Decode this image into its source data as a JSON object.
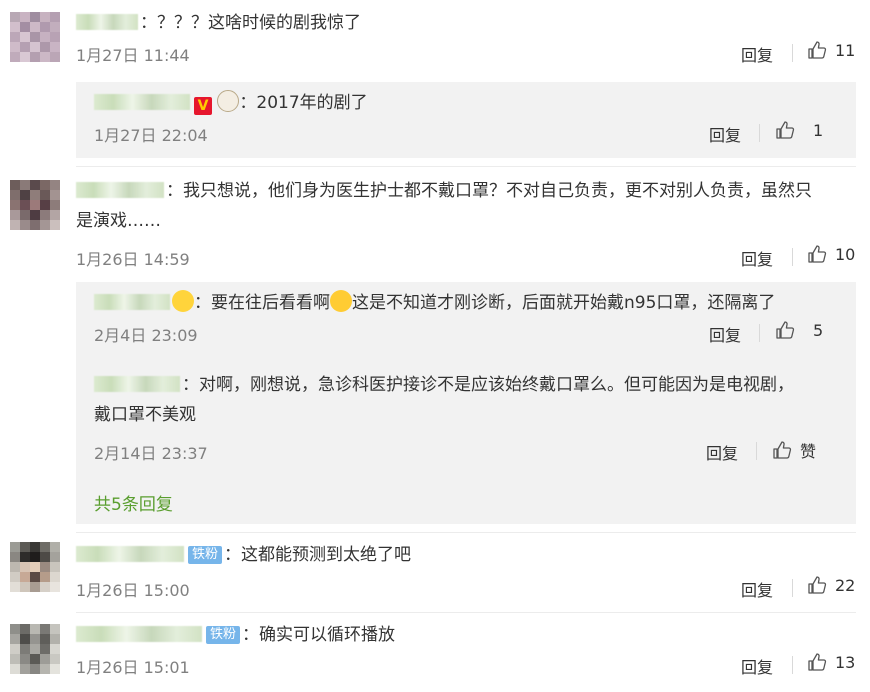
{
  "colors": {
    "link_green": "#5a9e2f",
    "badge_blue": "#76b5ea",
    "subbox_bg": "#f2f2f2",
    "meta_gray": "#808080"
  },
  "comments": [
    {
      "text": "：？？？这啥时候的剧我惊了",
      "time": "1月27日 11:44",
      "reply_label": "回复",
      "likes": "11",
      "replies": [
        {
          "text": "：2017年的剧了",
          "time": "1月27日 22:04",
          "reply_label": "回复",
          "likes": "1",
          "icons": [
            "v-badge",
            "sheep-emoji"
          ]
        }
      ]
    },
    {
      "text_line1": "：我只想说，他们身为医生护士都不戴口罩？不对自己负责，更不对别人负责，虽然只",
      "text_line2": "是演戏……",
      "time": "1月26日 14:59",
      "reply_label": "回复",
      "likes": "10",
      "replies": [
        {
          "text_a": "：要在往后看看啊",
          "text_b": "这是不知道才刚诊断，后面就开始戴n95口罩，还隔离了",
          "time": "2月4日 23:09",
          "reply_label": "回复",
          "likes": "5",
          "icons": [
            "angry-emoji",
            "laugh-cry-emoji"
          ]
        },
        {
          "text_line1": "：对啊，刚想说，急诊科医护接诊不是应该始终戴口罩么。但可能因为是电视剧，",
          "text_line2": "戴口罩不美观",
          "time": "2月14日 23:37",
          "reply_label": "回复",
          "likes": "赞"
        }
      ],
      "more_replies": "共5条回复"
    },
    {
      "badge": "铁粉",
      "text": "：这都能预测到太绝了吧",
      "time": "1月26日 15:00",
      "reply_label": "回复",
      "likes": "22"
    },
    {
      "badge": "铁粉",
      "text": "：确实可以循环播放",
      "time": "1月26日 15:01",
      "reply_label": "回复",
      "likes": "13"
    }
  ]
}
